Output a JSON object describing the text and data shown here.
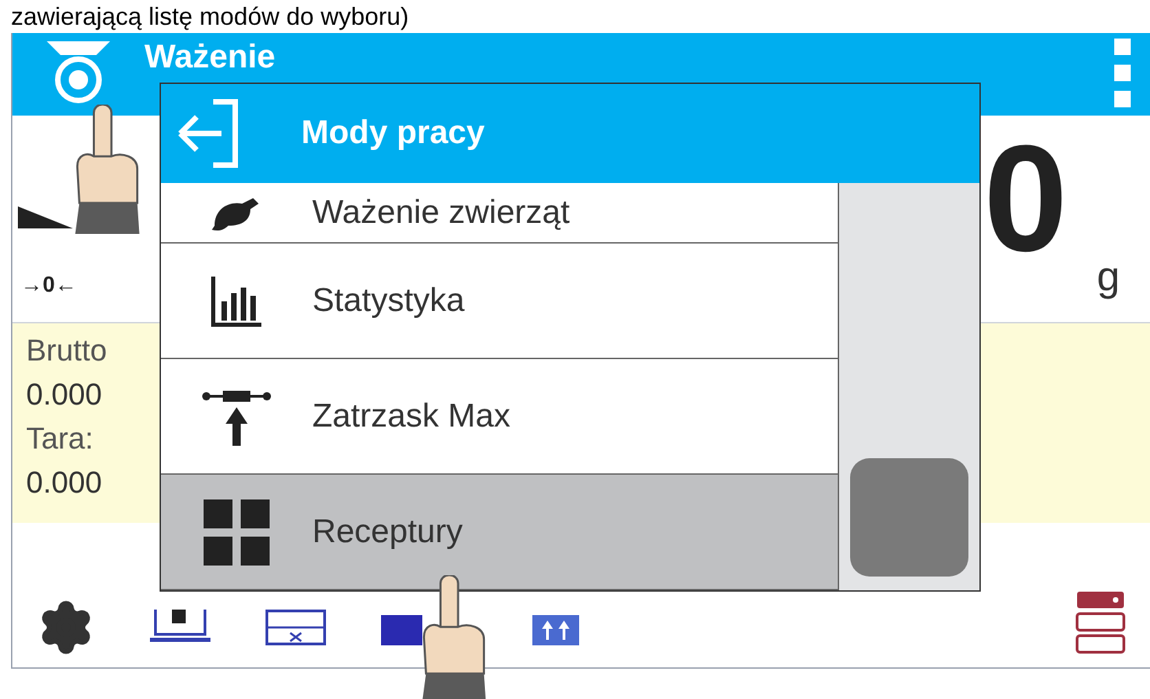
{
  "caption": "zawierającą listę modów do wyboru)",
  "header": {
    "title": "Ważenie"
  },
  "display": {
    "zero_indicator": "→0←",
    "reading": "0",
    "unit": "g"
  },
  "info": [
    {
      "label": "Brutto",
      "value": "0.000"
    },
    {
      "label": "Tara:",
      "value": "0.000"
    }
  ],
  "dialog": {
    "title": "Mody pracy",
    "items": [
      {
        "label": "Ważenie zwierząt",
        "kind": "animal",
        "selected": false
      },
      {
        "label": "Statystyka",
        "kind": "stats",
        "selected": false
      },
      {
        "label": "Zatrzask Max",
        "kind": "latch",
        "selected": false
      },
      {
        "label": "Receptury",
        "kind": "recipes",
        "selected": true
      }
    ]
  }
}
